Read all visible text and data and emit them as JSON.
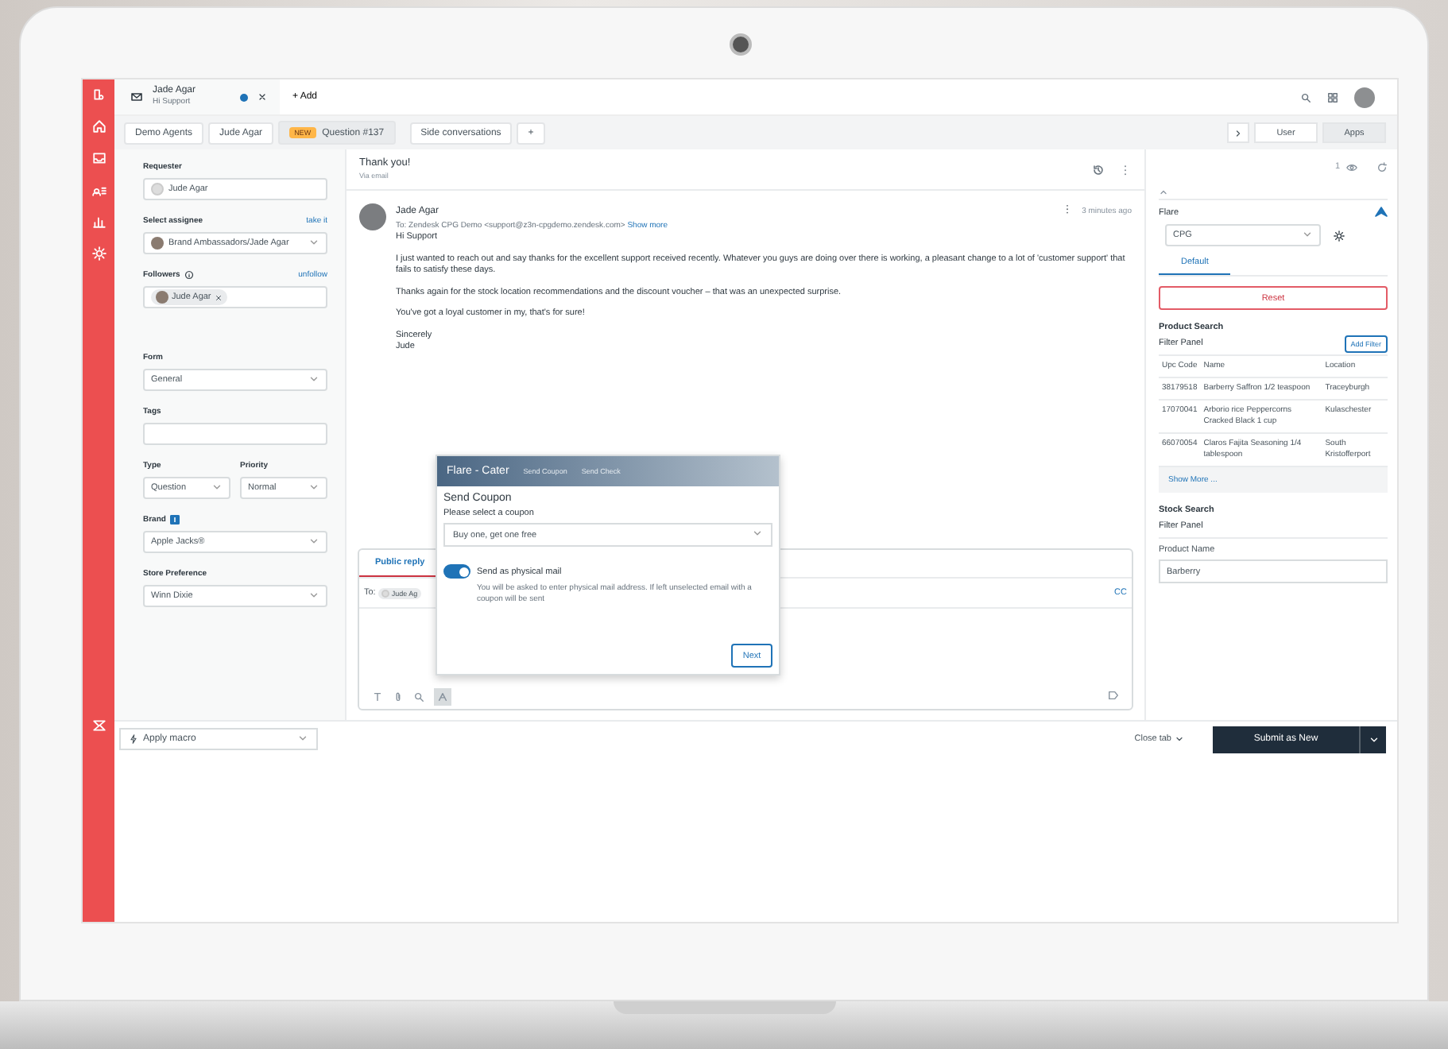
{
  "top_bar": {
    "ticket_tab": {
      "title": "Jade Agar",
      "subtitle": "Hi Support",
      "unread": true
    },
    "add_label": "+ Add"
  },
  "breadcrumbs": [
    {
      "label": "Demo Agents",
      "selected": false
    },
    {
      "label": "Jude Agar",
      "selected": false
    },
    {
      "badge": "NEW",
      "label": "Question #137",
      "selected": true
    }
  ],
  "side_conversations": {
    "label": "Side conversations",
    "add": "+"
  },
  "context_tabs": [
    {
      "label": "User",
      "selected": false
    },
    {
      "label": "Apps",
      "selected": true
    }
  ],
  "property_groups": [
    {
      "fields": [
        {
          "kind": "text",
          "label": "Requester",
          "value": "Jude Agar",
          "avatar": true
        },
        {
          "kind": "select",
          "label": "Select assignee",
          "link": "take it",
          "value": "Brand Ambassadors/Jade Agar",
          "avatar": true
        },
        {
          "kind": "chips",
          "label": "Followers",
          "info_icon": true,
          "link": "unfollow",
          "value": "Jude Agar",
          "avatar": true
        }
      ]
    },
    {
      "fields": [
        {
          "kind": "select",
          "label": "Form",
          "value": "General"
        },
        {
          "kind": "text",
          "label": "Tags"
        },
        {
          "kind": "pair",
          "items": [
            {
              "label": "Type",
              "value": "Question"
            },
            {
              "label": "Priority",
              "value": "Normal"
            }
          ]
        },
        {
          "kind": "select",
          "label": "Brand",
          "badge_icon": true,
          "value": "Apple Jacks®"
        },
        {
          "kind": "select",
          "label": "Store Preference",
          "value": "Winn Dixie"
        }
      ]
    }
  ],
  "conversation": {
    "subject": "Thank you!",
    "channel": "Via email",
    "message": {
      "author": "Jade Agar",
      "time": "3 minutes ago",
      "to": "To: Zendesk CPG Demo <support@z3n-cpgdemo.zendesk.com>",
      "show_more": "Show more",
      "paragraphs": [
        "Hi Support",
        "I just wanted to reach out and say thanks for the excellent support received recently. Whatever you guys are doing over there is working, a pleasant change to a lot of 'customer support' that fails to satisfy these days.",
        "Thanks again for the stock location recommendations and the discount voucher – that was an unexpected surprise.",
        "You've got a loyal customer in my, that's for sure!"
      ],
      "closing": [
        "Sincerely",
        "Jude"
      ]
    }
  },
  "composer": {
    "tab": "Public reply",
    "to_label": "To:",
    "recipient": "Jude Ag",
    "cc": "CC"
  },
  "popup": {
    "app": "Flare - Cater",
    "nav": [
      "Send Coupon",
      "Send Check"
    ],
    "title": "Send Coupon",
    "prompt": "Please select a coupon",
    "coupon": "Buy one, get one free",
    "toggle": {
      "label": "Send as physical mail",
      "on": true,
      "help": "You will be asked to enter physical mail address. If left unselected email with a coupon will be sent"
    },
    "next": "Next"
  },
  "footer": {
    "macro": "Apply macro",
    "close_tab": "Close tab",
    "submit": "Submit as New"
  },
  "apps": {
    "count": "1",
    "app_name": "Flare",
    "brand_select": "CPG",
    "tabs": [
      {
        "label": "Default",
        "selected": true
      }
    ],
    "reset": "Reset",
    "product_search": {
      "title": "Product Search",
      "filter": "Filter Panel",
      "add_filter": "Add Filter",
      "columns": [
        "Upc Code",
        "Name",
        "Location"
      ],
      "rows": [
        [
          "38179518",
          "Barberry Saffron 1/2 teaspoon",
          "Traceyburgh"
        ],
        [
          "17070041",
          "Arborio rice Peppercorns Cracked Black 1 cup",
          "Kulaschester"
        ],
        [
          "66070054",
          "Claros Fajita Seasoning 1/4 tablespoon",
          "South Kristofferport"
        ]
      ],
      "show_more": "Show More ..."
    },
    "stock_search": {
      "title": "Stock Search",
      "filter": "Filter Panel",
      "field_label": "Product Name",
      "field_value": "Barberry"
    }
  }
}
